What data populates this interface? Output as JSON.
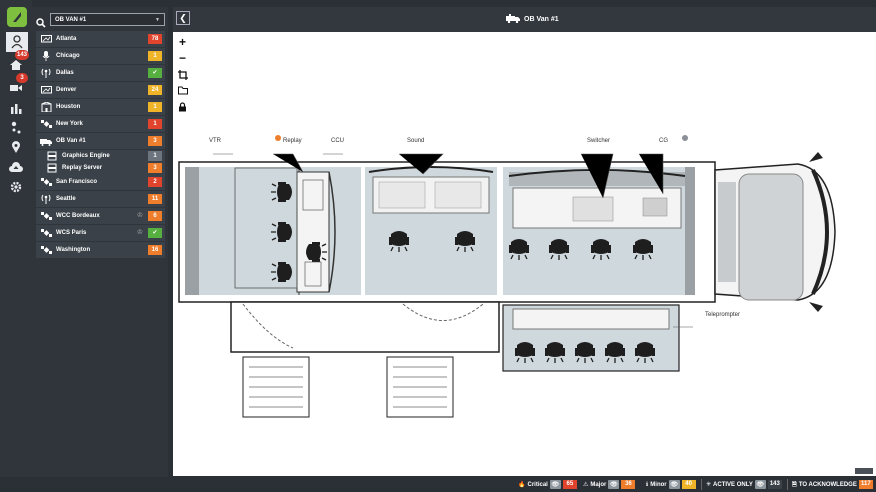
{
  "app": {
    "title": "OB Van #1"
  },
  "rail": {
    "badges": {
      "notifications": "143",
      "video": "3"
    }
  },
  "search": {
    "selected": "OB VAN #1"
  },
  "sites": [
    {
      "name": "Atlanta",
      "count": "78",
      "color": "red",
      "icon": "monitor-icon"
    },
    {
      "name": "Chicago",
      "count": "1",
      "color": "yellow",
      "icon": "microphone-icon"
    },
    {
      "name": "Dallas",
      "count": "✔",
      "color": "green",
      "icon": "antenna-icon"
    },
    {
      "name": "Denver",
      "count": "24",
      "color": "yellow",
      "icon": "monitor-icon"
    },
    {
      "name": "Houston",
      "count": "1",
      "color": "yellow",
      "icon": "building-icon"
    },
    {
      "name": "New York",
      "count": "1",
      "color": "red",
      "icon": "satellite-icon"
    },
    {
      "name": "OB Van #1",
      "count": "3",
      "color": "orange",
      "icon": "van-icon"
    },
    {
      "name": "Graphics Engine",
      "count": "1",
      "color": "grey",
      "icon": "server-icon",
      "sub": true
    },
    {
      "name": "Replay Server",
      "count": "3",
      "color": "orange",
      "icon": "server-icon",
      "sub": true
    },
    {
      "name": "San Francisco",
      "count": "2",
      "color": "red",
      "icon": "satellite-icon"
    },
    {
      "name": "Seattle",
      "count": "11",
      "color": "orange",
      "icon": "antenna-icon"
    },
    {
      "name": "WCC Bordeaux",
      "count": "6",
      "color": "orange",
      "icon": "satellite-icon",
      "crown": true
    },
    {
      "name": "WCS Paris",
      "count": "✔",
      "color": "green",
      "icon": "satellite-icon",
      "crown": true
    },
    {
      "name": "Washington",
      "count": "16",
      "color": "orange",
      "icon": "satellite-icon"
    }
  ],
  "plan": {
    "labels": {
      "vtr": "VTR",
      "replay": "Replay",
      "ccu": "CCU",
      "sound": "Sound",
      "switcher": "Switcher",
      "cg": "CG",
      "teleprompter": "Teleprompter"
    },
    "status_dots": {
      "replay": "#ee7d2c",
      "cg": "#8a9096"
    }
  },
  "status": {
    "critical": {
      "label": "Critical",
      "value": "65"
    },
    "major": {
      "label": "Major",
      "value": "36"
    },
    "minor": {
      "label": "Minor",
      "value": "40"
    },
    "active_only": {
      "label": "ACTIVE ONLY",
      "value": "143"
    },
    "to_ack": {
      "label": "TO ACKNOWLEDGE",
      "value": "117"
    }
  },
  "colors": {
    "red": "#e0442c",
    "yellow": "#f0b429",
    "orange": "#ee7d2c",
    "green": "#55b040",
    "grey": "#6c757d"
  }
}
